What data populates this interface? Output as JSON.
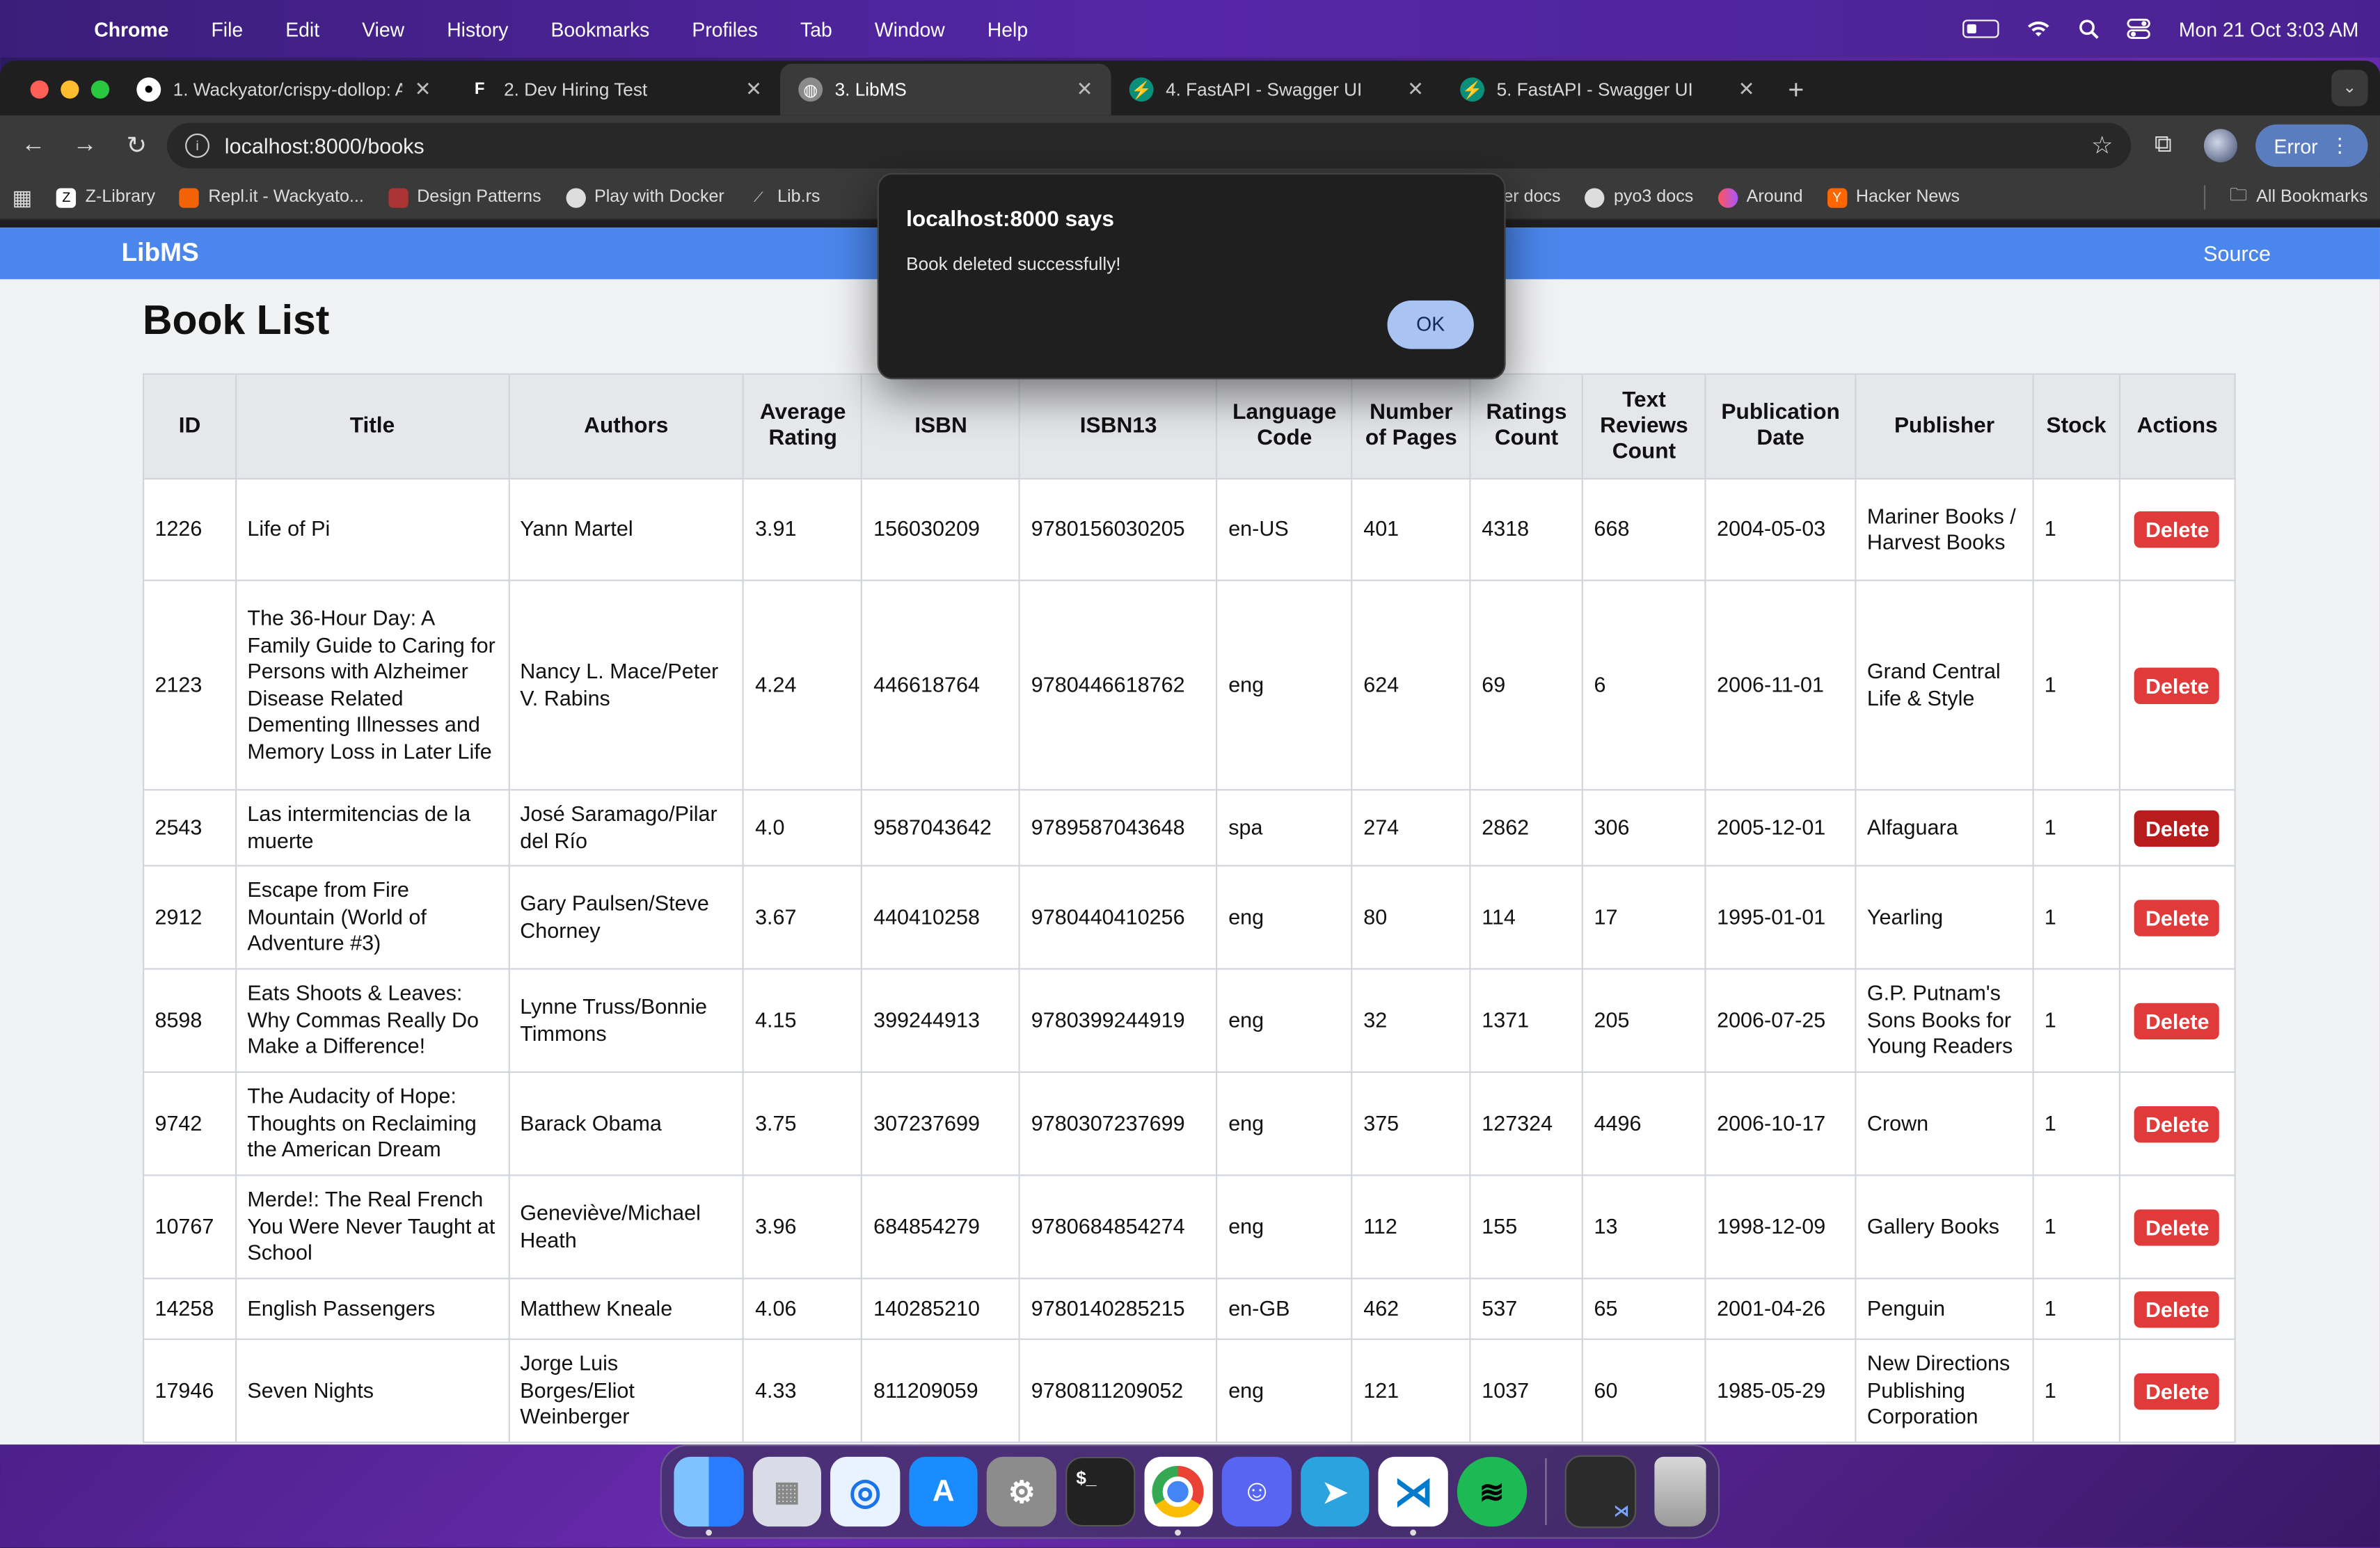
{
  "menubar": {
    "app": "Chrome",
    "items": [
      "File",
      "Edit",
      "View",
      "History",
      "Bookmarks",
      "Profiles",
      "Tab",
      "Window",
      "Help"
    ],
    "datetime": "Mon 21 Oct  3:03 AM"
  },
  "tabs": [
    {
      "label": "1. Wackyator/crispy-dollop: A",
      "icon": "github-icon"
    },
    {
      "label": "2. Dev Hiring Test",
      "icon": "doc-icon"
    },
    {
      "label": "3. LibMS",
      "icon": "globe-icon"
    },
    {
      "label": "4. FastAPI - Swagger UI",
      "icon": "fastapi-icon"
    },
    {
      "label": "5. FastAPI - Swagger UI",
      "icon": "fastapi-icon"
    }
  ],
  "toolbar": {
    "url": "localhost:8000/books",
    "status_chip": "Error"
  },
  "bookmarks": {
    "items": [
      "Z-Library",
      "Repl.it - Wackyato...",
      "Design Patterns",
      "Play with Docker",
      "Lib.rs",
      "rattler docs",
      "pyo3 docs",
      "Around",
      "Hacker News"
    ],
    "all": "All Bookmarks"
  },
  "page": {
    "brand": "LibMS",
    "source_link": "Source",
    "title": "Book List",
    "delete_label": "Delete"
  },
  "table": {
    "headers": [
      "ID",
      "Title",
      "Authors",
      "Average Rating",
      "ISBN",
      "ISBN13",
      "Language Code",
      "Number of Pages",
      "Ratings Count",
      "Text Reviews Count",
      "Publication Date",
      "Publisher",
      "Stock",
      "Actions"
    ],
    "rows": [
      [
        "1226",
        "Life of Pi",
        "Yann Martel",
        "3.91",
        "156030209",
        "9780156030205",
        "en-US",
        "401",
        "4318",
        "668",
        "2004-05-03",
        "Mariner Books / Harvest Books",
        "1"
      ],
      [
        "2123",
        "The 36-Hour Day: A Family Guide to Caring for Persons with Alzheimer Disease Related Dementing Illnesses and Memory Loss in Later Life",
        "Nancy L. Mace/Peter V. Rabins",
        "4.24",
        "446618764",
        "9780446618762",
        "eng",
        "624",
        "69",
        "6",
        "2006-11-01",
        "Grand Central Life & Style",
        "1"
      ],
      [
        "2543",
        "Las intermitencias de la muerte",
        "José Saramago/Pilar del Río",
        "4.0",
        "9587043642",
        "9789587043648",
        "spa",
        "274",
        "2862",
        "306",
        "2005-12-01",
        "Alfaguara",
        "1"
      ],
      [
        "2912",
        "Escape from Fire Mountain (World of Adventure #3)",
        "Gary Paulsen/Steve Chorney",
        "3.67",
        "440410258",
        "9780440410256",
        "eng",
        "80",
        "114",
        "17",
        "1995-01-01",
        "Yearling",
        "1"
      ],
      [
        "8598",
        "Eats Shoots & Leaves: Why Commas Really Do Make a Difference!",
        "Lynne Truss/Bonnie Timmons",
        "4.15",
        "399244913",
        "9780399244919",
        "eng",
        "32",
        "1371",
        "205",
        "2006-07-25",
        "G.P. Putnam's Sons Books for Young Readers",
        "1"
      ],
      [
        "9742",
        "The Audacity of Hope: Thoughts on Reclaiming the American Dream",
        "Barack Obama",
        "3.75",
        "307237699",
        "9780307237699",
        "eng",
        "375",
        "127324",
        "4496",
        "2006-10-17",
        "Crown",
        "1"
      ],
      [
        "10767",
        "Merde!: The Real French You Were Never Taught at School",
        "Geneviève/Michael Heath",
        "3.96",
        "684854279",
        "9780684854274",
        "eng",
        "112",
        "155",
        "13",
        "1998-12-09",
        "Gallery Books",
        "1"
      ],
      [
        "14258",
        "English Passengers",
        "Matthew Kneale",
        "4.06",
        "140285210",
        "9780140285215",
        "en-GB",
        "462",
        "537",
        "65",
        "2001-04-26",
        "Penguin",
        "1"
      ],
      [
        "17946",
        "Seven Nights",
        "Jorge Luis Borges/Eliot Weinberger",
        "4.33",
        "811209059",
        "9780811209052",
        "eng",
        "121",
        "1037",
        "60",
        "1985-05-29",
        "New Directions Publishing Corporation",
        "1"
      ]
    ]
  },
  "alert": {
    "title": "localhost:8000 says",
    "message": "Book deleted successfully!",
    "ok_label": "OK"
  },
  "dock": {
    "apps": [
      "finder-icon",
      "launchpad-icon",
      "safari-icon",
      "app-store-icon",
      "system-settings-icon",
      "terminal-icon",
      "chrome-icon",
      "discord-icon",
      "telegram-icon",
      "vscode-icon",
      "spotify-icon",
      "window-preview-icon",
      "trash-icon"
    ]
  },
  "colors": {
    "nav_blue": "#4a86ec",
    "delete_red": "#e03a3a",
    "delete_hover": "#b91c1c",
    "ok_button": "#a9c3f3"
  }
}
